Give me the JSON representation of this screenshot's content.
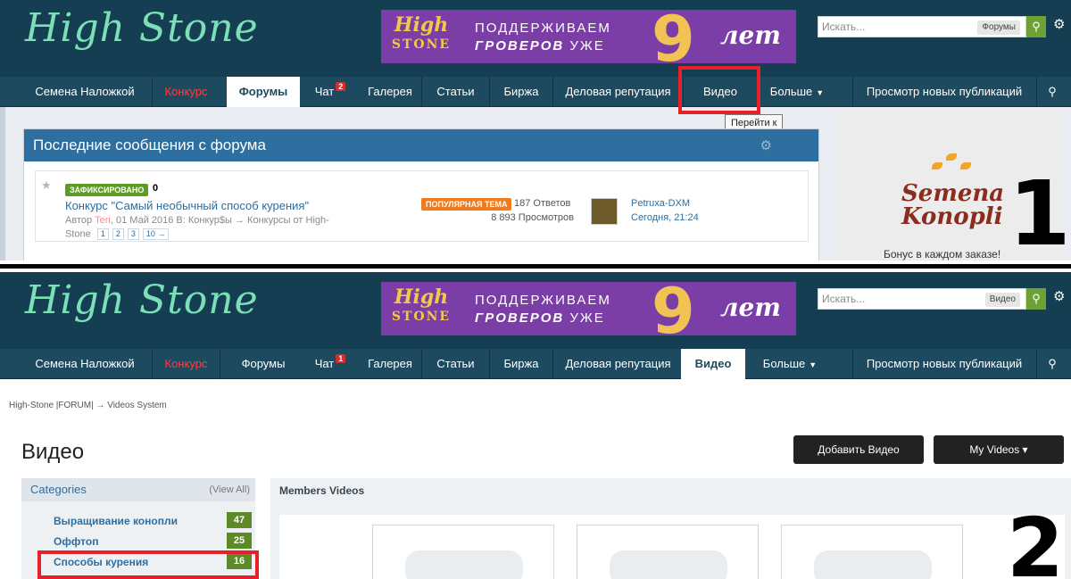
{
  "header": {
    "logo_text": "High Stone",
    "banner": {
      "logo_top": "High",
      "logo_bottom": "STONE",
      "line1": "ПОДДЕРЖИВАЕМ",
      "line2_bold": "ГРОВЕРОВ",
      "line2_rest": "УЖЕ",
      "number": "9",
      "years": "лет"
    },
    "search_placeholder": "Искать..."
  },
  "panel1": {
    "search_scope": "Форумы",
    "nav": [
      {
        "label": "Семена Наложкой"
      },
      {
        "label": "Конкурс"
      },
      {
        "label": "Форумы"
      },
      {
        "label": "Чат",
        "badge": "2"
      },
      {
        "label": "Галерея"
      },
      {
        "label": "Статьи"
      },
      {
        "label": "Биржа"
      },
      {
        "label": "Деловая репутация"
      },
      {
        "label": "Видео"
      },
      {
        "label": "Больше"
      },
      {
        "label": "Просмотр новых публикаций"
      }
    ],
    "tooltip": "Перейти к",
    "block_title": "Последние сообщения с форума",
    "post": {
      "pinned": "ЗАФИКСИРОВАНО",
      "pin_extra": "0",
      "title": "Конкурс \"Самый необычный способ курения\"",
      "meta_prefix": "Автор",
      "author": "Teri",
      "meta_rest": ", 01 Май 2016 В: Конкур$ы → Конкурсы от High-",
      "meta_line2": "Stone",
      "pages": [
        "1",
        "2",
        "3",
        "10 →"
      ],
      "hot": "ПОПУЛЯРНАЯ ТЕМА",
      "replies": "187 Ответов",
      "views": "8 893 Просмотров",
      "last_user": "Petruxa-DXM",
      "last_date": "Сегодня, 21:24"
    },
    "ad": {
      "brand1": "Semena",
      "brand2": "Konopli",
      "bonus": "Бонус в каждом заказе!"
    },
    "step": "1"
  },
  "panel2": {
    "search_scope": "Видео",
    "nav": [
      {
        "label": "Семена Наложкой"
      },
      {
        "label": "Конкурс"
      },
      {
        "label": "Форумы"
      },
      {
        "label": "Чат",
        "badge": "1"
      },
      {
        "label": "Галерея"
      },
      {
        "label": "Статьи"
      },
      {
        "label": "Биржа"
      },
      {
        "label": "Деловая репутация"
      },
      {
        "label": "Видео"
      },
      {
        "label": "Больше"
      },
      {
        "label": "Просмотр новых публикаций"
      }
    ],
    "breadcrumb": "High-Stone |FORUM|  →  Videos System",
    "title": "Видео",
    "add_video": "Добавить Видео",
    "my_videos": "My Videos ▾",
    "categories_title": "Categories",
    "view_all": "(View All)",
    "categories": [
      {
        "label": "Выращивание конопли",
        "count": "47"
      },
      {
        "label": "Оффтоп",
        "count": "25"
      },
      {
        "label": "Способы курения",
        "count": "16"
      }
    ],
    "members_videos": "Members Videos",
    "step": "2"
  },
  "colors": {
    "header_bg": "#153e52",
    "nav_bg": "#1e4a60",
    "highlight": "#e8202a",
    "accent_blue": "#2e6fa0",
    "count_green": "#5d8a27"
  }
}
